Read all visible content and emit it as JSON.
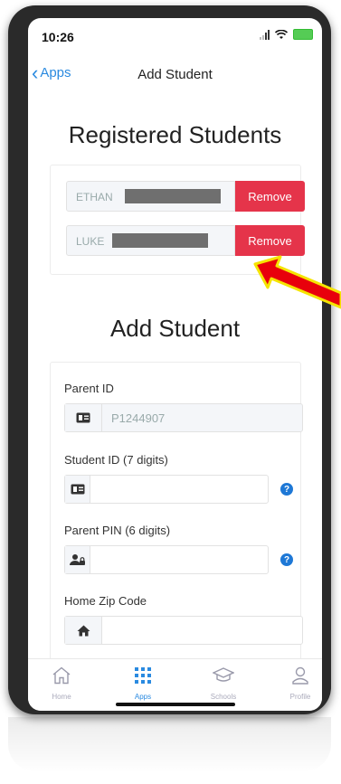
{
  "status": {
    "time": "10:26"
  },
  "nav": {
    "back_label": "Apps",
    "title": "Add Student"
  },
  "registered": {
    "heading": "Registered Students",
    "students": [
      {
        "name": "ETHAN",
        "remove_label": "Remove"
      },
      {
        "name": "LUKE",
        "remove_label": "Remove"
      }
    ]
  },
  "add": {
    "heading": "Add Student",
    "parent_id": {
      "label": "Parent ID",
      "value": "P1244907",
      "icon": "id-card-icon"
    },
    "student_id": {
      "label": "Student ID (7 digits)",
      "value": "",
      "icon": "id-card-icon",
      "help": "?"
    },
    "parent_pin": {
      "label": "Parent PIN (6 digits)",
      "value": "",
      "icon": "user-lock-icon",
      "help": "?"
    },
    "zip": {
      "label": "Home Zip Code",
      "value": "",
      "icon": "home-icon"
    }
  },
  "tabs": [
    {
      "label": "Home",
      "icon": "home-outline-icon"
    },
    {
      "label": "Apps",
      "icon": "grid-icon",
      "active": true
    },
    {
      "label": "Schools",
      "icon": "graduation-cap-icon"
    },
    {
      "label": "Profile",
      "icon": "person-icon"
    }
  ],
  "colors": {
    "accent": "#2a8ae0",
    "remove": "#e5344a",
    "annotation_arrow": "#e8000c"
  }
}
